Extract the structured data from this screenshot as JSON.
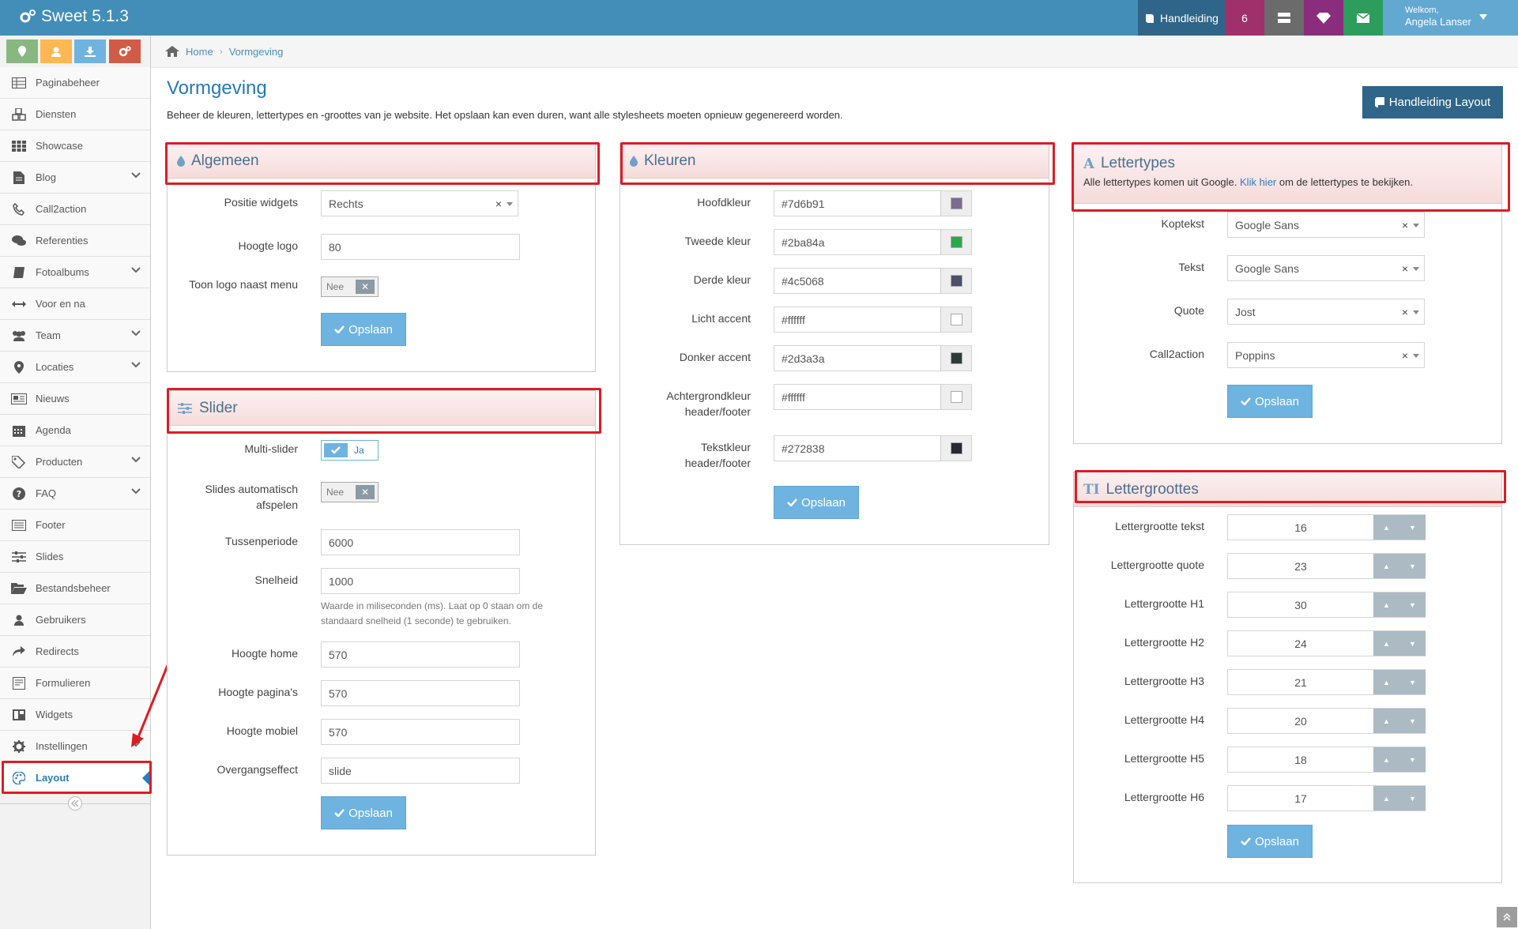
{
  "navbar": {
    "brand": "Sweet 5.1.3",
    "manual_label": "Handleiding",
    "badge_count": "6",
    "welcome_label": "Welkom,",
    "user_name": "Angela Lanser",
    "colors": {
      "bg": "#438eb9",
      "manual": "#2e6589",
      "badge": "#a0306c",
      "grey": "#6b6b6b",
      "purple": "#8a2d7d",
      "green": "#2e9c5c"
    }
  },
  "shortcuts": [
    {
      "icon": "map-pin-icon",
      "color": "#87b87f"
    },
    {
      "icon": "user-icon",
      "color": "#ffb752"
    },
    {
      "icon": "download-icon",
      "color": "#6fb3e0"
    },
    {
      "icon": "cogs-icon",
      "color": "#d15b47"
    }
  ],
  "sidebar": {
    "items": [
      {
        "label": "Paginabeheer",
        "icon": "table-icon"
      },
      {
        "label": "Diensten",
        "icon": "cubes-icon"
      },
      {
        "label": "Showcase",
        "icon": "grid-icon"
      },
      {
        "label": "Blog",
        "icon": "file-icon",
        "has_children": true
      },
      {
        "label": "Call2action",
        "icon": "phone-icon"
      },
      {
        "label": "Referenties",
        "icon": "comments-icon"
      },
      {
        "label": "Fotoalbums",
        "icon": "book-icon",
        "has_children": true
      },
      {
        "label": "Voor en na",
        "icon": "arrows-h-icon"
      },
      {
        "label": "Team",
        "icon": "users-icon",
        "has_children": true
      },
      {
        "label": "Locaties",
        "icon": "map-marker-icon",
        "has_children": true
      },
      {
        "label": "Nieuws",
        "icon": "newspaper-icon"
      },
      {
        "label": "Agenda",
        "icon": "calendar-icon"
      },
      {
        "label": "Producten",
        "icon": "tags-icon",
        "has_children": true
      },
      {
        "label": "FAQ",
        "icon": "question-circle-icon",
        "has_children": true
      },
      {
        "label": "Footer",
        "icon": "list-alt-icon"
      },
      {
        "label": "Slides",
        "icon": "sliders-icon"
      },
      {
        "label": "Bestandsbeheer",
        "icon": "folder-open-icon"
      },
      {
        "label": "Gebruikers",
        "icon": "user-icon"
      },
      {
        "label": "Redirects",
        "icon": "share-icon"
      },
      {
        "label": "Formulieren",
        "icon": "form-icon"
      },
      {
        "label": "Widgets",
        "icon": "columns-icon"
      },
      {
        "label": "Instellingen",
        "icon": "cog-icon",
        "has_children": true
      },
      {
        "label": "Layout",
        "icon": "palette-icon",
        "active": true
      }
    ]
  },
  "breadcrumb": {
    "home": "Home",
    "current": "Vormgeving"
  },
  "page": {
    "title": "Vormgeving",
    "description": "Beheer de kleuren, lettertypes en -groottes van je website. Het opslaan kan even duren, want alle stylesheets moeten opnieuw gegenereerd worden.",
    "manual_button": "Handleiding Layout"
  },
  "save_label": "Opslaan",
  "algemeen": {
    "title": "Algemeen",
    "positie_label": "Positie widgets",
    "positie_value": "Rechts",
    "hoogte_logo_label": "Hoogte logo",
    "hoogte_logo_value": "80",
    "toon_logo_label": "Toon logo naast menu",
    "toon_logo_value": "Nee"
  },
  "slider": {
    "title": "Slider",
    "multi_label": "Multi-slider",
    "multi_value": "Ja",
    "auto_label_1": "Slides automatisch",
    "auto_label_2": "afspelen",
    "auto_value": "Nee",
    "tussen_label": "Tussenperiode",
    "tussen_value": "6000",
    "snelheid_label": "Snelheid",
    "snelheid_value": "1000",
    "snelheid_help_1": "Waarde in miliseconden (ms). Laat op 0 staan om de",
    "snelheid_help_2": "standaard snelheid (1 seconde) te gebruiken.",
    "home_label": "Hoogte home",
    "home_value": "570",
    "pagina_label": "Hoogte pagina's",
    "pagina_value": "570",
    "mobiel_label": "Hoogte mobiel",
    "mobiel_value": "570",
    "effect_label": "Overgangseffect",
    "effect_value": "slide"
  },
  "kleuren": {
    "title": "Kleuren",
    "rows": [
      {
        "label_1": "Hoofdkleur",
        "label_2": "",
        "value": "#7d6b91",
        "color": "#7d6b91"
      },
      {
        "label_1": "Tweede kleur",
        "label_2": "",
        "value": "#2ba84a",
        "color": "#2ba84a"
      },
      {
        "label_1": "Derde kleur",
        "label_2": "",
        "value": "#4c5068",
        "color": "#4c5068"
      },
      {
        "label_1": "Licht accent",
        "label_2": "",
        "value": "#ffffff",
        "color": "#ffffff"
      },
      {
        "label_1": "Donker accent",
        "label_2": "",
        "value": "#2d3a3a",
        "color": "#2d3a3a"
      },
      {
        "label_1": "Achtergrondkleur",
        "label_2": "header/footer",
        "value": "#ffffff",
        "color": "#ffffff"
      },
      {
        "label_1": "Tekstkleur",
        "label_2": "header/footer",
        "value": "#272838",
        "color": "#272838"
      }
    ]
  },
  "lettertypes": {
    "title": "Lettertypes",
    "note_before": "Alle lettertypes komen uit Google.",
    "note_link": "Klik hier",
    "note_after": "om de lettertypes te bekijken.",
    "rows": [
      {
        "label": "Koptekst",
        "value": "Google Sans"
      },
      {
        "label": "Tekst",
        "value": "Google Sans"
      },
      {
        "label": "Quote",
        "value": "Jost"
      },
      {
        "label": "Call2action",
        "value": "Poppins"
      }
    ]
  },
  "lettergroottes": {
    "title": "Lettergroottes",
    "rows": [
      {
        "label": "Lettergrootte tekst",
        "value": "16"
      },
      {
        "label": "Lettergrootte quote",
        "value": "23"
      },
      {
        "label": "Lettergrootte H1",
        "value": "30"
      },
      {
        "label": "Lettergrootte H2",
        "value": "24"
      },
      {
        "label": "Lettergrootte H3",
        "value": "21"
      },
      {
        "label": "Lettergrootte H4",
        "value": "20"
      },
      {
        "label": "Lettergrootte H5",
        "value": "18"
      },
      {
        "label": "Lettergrootte H6",
        "value": "17"
      }
    ]
  }
}
